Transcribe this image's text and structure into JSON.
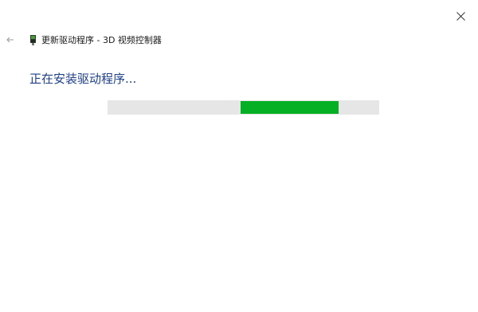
{
  "window": {
    "title": "更新驱动程序 - 3D 视频控制器",
    "close_icon": "close-icon",
    "back_icon": "back-arrow-icon",
    "device_icon": "graphics-card-icon"
  },
  "main": {
    "status": "正在安装驱动程序..."
  },
  "progress": {
    "mode": "indeterminate",
    "segment_start_fraction": 0.49,
    "segment_end_fraction": 0.85,
    "track_color": "#e6e6e6",
    "fill_color": "#06b025"
  },
  "colors": {
    "status_text": "#1e3f8a",
    "background": "#ffffff"
  }
}
